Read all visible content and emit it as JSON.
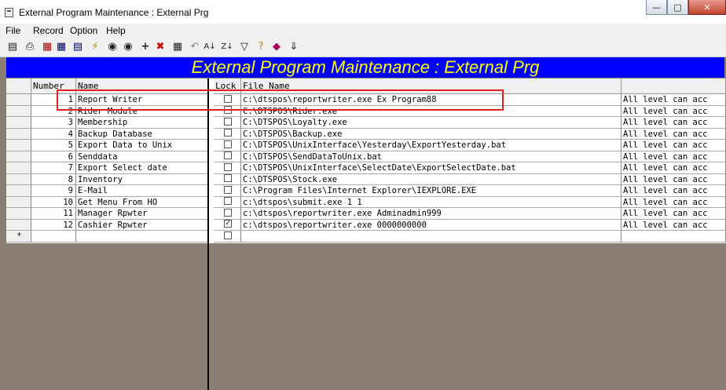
{
  "window": {
    "title": "External Program Maintenance : External Prg"
  },
  "menu": [
    "File",
    "Record",
    "Option",
    "Help"
  ],
  "toolbar_icons": [
    "print-setup-icon",
    "printer-icon",
    "report-icon",
    "calendar-icon",
    "form-icon",
    "lightning-icon",
    "binoculars-icon",
    "binoculars-next-icon",
    "add-icon",
    "delete-icon",
    "grid-icon",
    "undo-icon",
    "sort-asc-icon",
    "sort-desc-icon",
    "filter-icon",
    "help-icon",
    "eraser-icon",
    "exit-icon"
  ],
  "banner": "External Program Maintenance : External Prg",
  "columns": {
    "number": "Number",
    "name": "Name",
    "lock": "Lock",
    "file_name": "File Name",
    "extra": ""
  },
  "rows": [
    {
      "number": "1",
      "name": "Report Writer",
      "lock": false,
      "file": "c:\\dtspos\\reportwriter.exe Ex Program88",
      "extra": "All level can acc"
    },
    {
      "number": "2",
      "name": "Rider Module",
      "lock": false,
      "file": "C:\\DTSPOS\\Rider.exe",
      "extra": "All level can acc"
    },
    {
      "number": "3",
      "name": "Membership",
      "lock": false,
      "file": "C:\\DTSPOS\\Loyalty.exe",
      "extra": "All level can acc"
    },
    {
      "number": "4",
      "name": "Backup Database",
      "lock": false,
      "file": "C:\\DTSPOS\\Backup.exe",
      "extra": "All level can acc"
    },
    {
      "number": "5",
      "name": "Export Data to Unix",
      "lock": false,
      "file": "C:\\DTSPOS\\UnixInterface\\Yesterday\\ExportYesterday.bat",
      "extra": "All level can acc"
    },
    {
      "number": "6",
      "name": "Senddata",
      "lock": false,
      "file": "C:\\DTSPOS\\SendDataToUnix.bat",
      "extra": "All level can acc"
    },
    {
      "number": "7",
      "name": "Export Select date",
      "lock": false,
      "file": "C:\\DTSPOS\\UnixInterface\\SelectDate\\ExportSelectDate.bat",
      "extra": "All level can acc"
    },
    {
      "number": "8",
      "name": "Inventory",
      "lock": false,
      "file": "C:\\DTSPOS\\Stock.exe",
      "extra": "All level can acc"
    },
    {
      "number": "9",
      "name": "E-Mail",
      "lock": false,
      "file": "C:\\Program Files\\Internet Explorer\\IEXPLORE.EXE",
      "extra": "All level can acc"
    },
    {
      "number": "10",
      "name": "Get Menu From HO",
      "lock": false,
      "file": "c:\\dtspos\\submit.exe 1 1",
      "extra": "All level can acc"
    },
    {
      "number": "11",
      "name": "Manager Rpwter",
      "lock": false,
      "file": "c:\\dtspos\\reportwriter.exe Adminadmin999",
      "extra": "All level can acc"
    },
    {
      "number": "12",
      "name": "Cashier Rpwter",
      "lock": true,
      "file": "c:\\dtspos\\reportwriter.exe 0000000000",
      "extra": "All level can acc"
    }
  ],
  "new_row_marker": "*",
  "check_mark": "✓"
}
